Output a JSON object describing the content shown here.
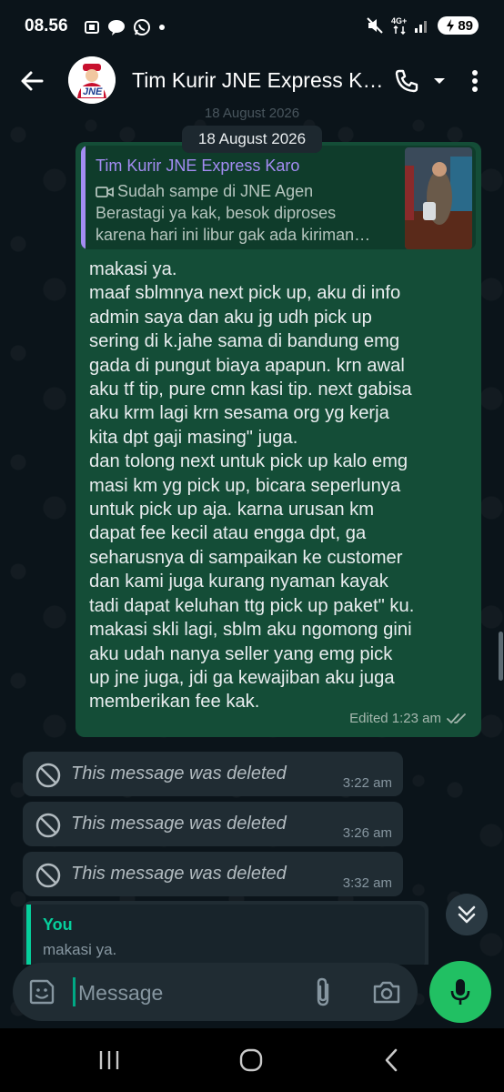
{
  "status_bar": {
    "time": "08.56",
    "battery": "89",
    "network": "4G+"
  },
  "header": {
    "contact_name": "Tim Kurir JNE Express Karo",
    "avatar_text": "JNE"
  },
  "chat": {
    "date_ghost": "18 August 2026",
    "date_chip": "18 August 2026",
    "outgoing": {
      "quoted_name": "Tim Kurir JNE Express Karo",
      "quoted_line1": "Sudah sampe di JNE Agen",
      "quoted_line2": "Berastagi ya kak, besok diproses",
      "quoted_line3": "karena hari ini libur gak ada kiriman…",
      "lines": [
        "makasi ya.",
        "maaf sblmnya next pick up, aku di info",
        "admin saya dan aku jg udh pick up",
        "sering di k.jahe sama di bandung emg",
        "gada di pungut biaya apapun. krn awal",
        "aku tf tip, pure cmn kasi tip. next gabisa",
        "aku krm lagi krn sesama org yg kerja",
        "kita dpt gaji masing\" juga.",
        "dan tolong next untuk pick up kalo emg",
        "masi km yg pick up, bicara seperlunya",
        "untuk pick up aja. karna urusan km",
        "dapat fee kecil atau engga dpt, ga",
        "seharusnya di sampaikan ke customer",
        "dan kami juga kurang nyaman kayak",
        "tadi dapat keluhan ttg pick up paket\" ku.",
        "makasi skli lagi, sblm aku ngomong gini",
        "aku udah nanya seller yang emg pick",
        "up jne juga, jdi ga kewajiban aku juga",
        "memberikan fee kak."
      ],
      "meta": "Edited 1:23 am"
    },
    "deleted": [
      {
        "text": "This message was deleted",
        "time": "3:22 am"
      },
      {
        "text": "This message was deleted",
        "time": "3:26 am"
      },
      {
        "text": "This message was deleted",
        "time": "3:32 am"
      }
    ],
    "reply_preview": {
      "name": "You",
      "text": "makasi ya."
    }
  },
  "composer": {
    "placeholder": "Message"
  },
  "colors": {
    "outgoing_bubble": "#144d37",
    "incoming_bubble": "#202c33",
    "accent_green": "#21c063",
    "quote_name": "#a38cf2"
  }
}
